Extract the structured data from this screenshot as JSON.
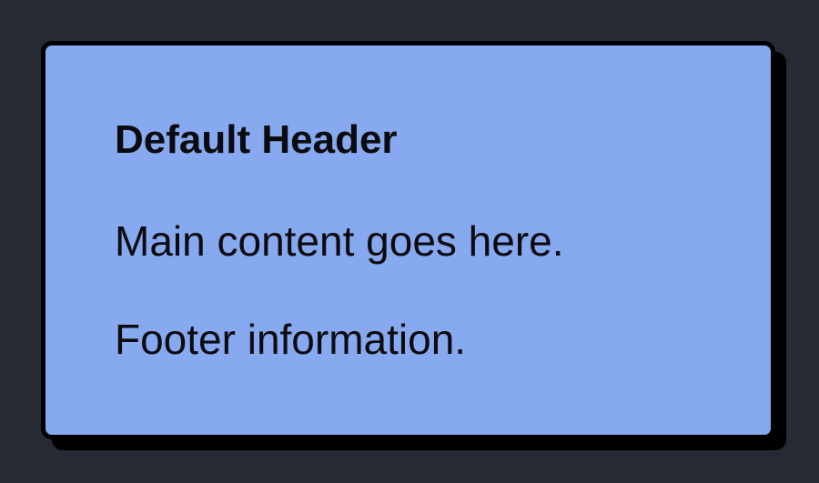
{
  "card": {
    "header": "Default Header",
    "content": "Main content goes here.",
    "footer": "Footer information."
  },
  "colors": {
    "page_background": "#282a33",
    "card_background": "#87a9f0",
    "card_border": "#000000",
    "text": "#0b0b0f"
  }
}
